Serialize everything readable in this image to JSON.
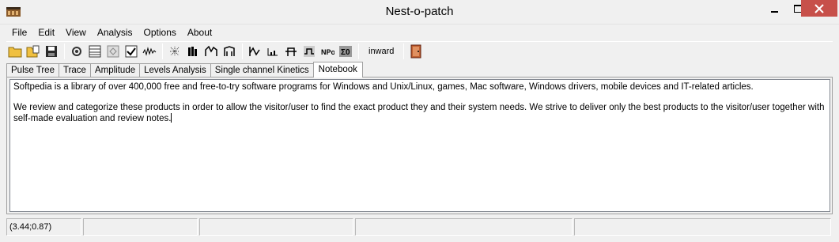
{
  "window": {
    "title": "Nest-o-patch",
    "icon": "app-icon",
    "controls": [
      "minimize-icon",
      "maximize-icon",
      "close-icon"
    ]
  },
  "menu": [
    "File",
    "Edit",
    "View",
    "Analysis",
    "Options",
    "About"
  ],
  "toolbar": {
    "groups": [
      [
        "open-folder-icon",
        "open-file-icon",
        "save-icon"
      ],
      [
        "settings-icon",
        "table-icon",
        "grid-icon",
        "check-icon",
        "wave-icon"
      ],
      [
        "spike-icon",
        "histogram-icon",
        "peak-icon",
        "bridge-icon"
      ],
      [
        "line-icon",
        "bar-icon",
        "bridge2-icon",
        "pulse-icon",
        "nps-icon",
        "zero-icon"
      ]
    ],
    "direction_label": "inward",
    "exit_icon": "exit-door-icon"
  },
  "tabs": [
    "Pulse Tree",
    "Trace",
    "Amplitude",
    "Levels Analysis",
    "Single channel Kinetics",
    "Notebook"
  ],
  "active_tab": 5,
  "notebook": {
    "text": "Softpedia is a library of over 400,000 free and free-to-try software programs for Windows and Unix/Linux, games, Mac software, Windows drivers, mobile devices and IT-related articles.\n\nWe review and categorize these products in order to allow the visitor/user to find the exact product they and their system needs. We strive to deliver only the best products to the visitor/user together with self-made evaluation and review notes."
  },
  "statusbar": {
    "coords": "(3.44;0.87)",
    "cells": [
      "",
      "",
      "",
      ""
    ]
  },
  "colors": {
    "close_button": "#c7504a",
    "background": "#f0f0f0"
  }
}
